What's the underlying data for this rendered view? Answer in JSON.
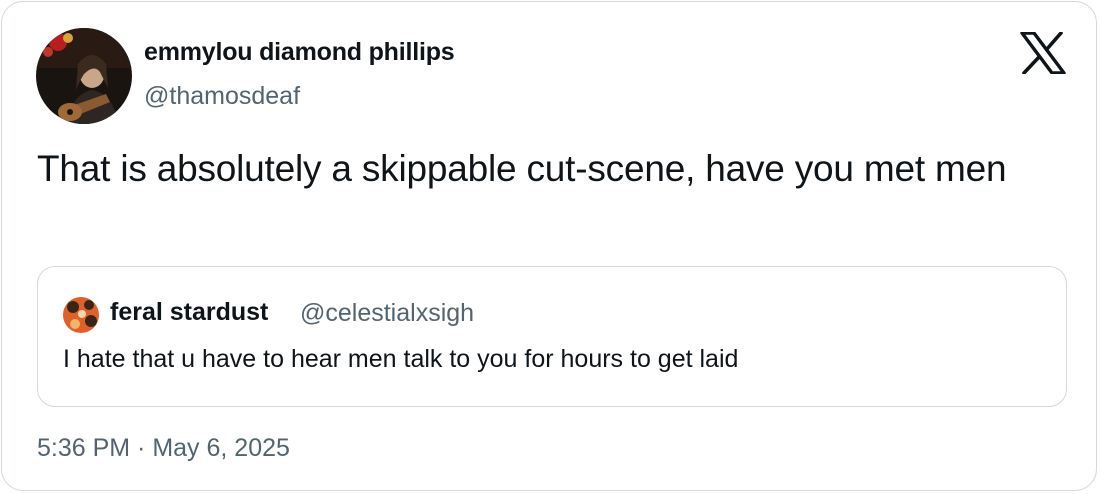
{
  "tweet": {
    "author_name": "emmylou diamond phillips",
    "author_handle": "@thamosdeaf",
    "text": "That is absolutely a skippable cut-scene, have you met men",
    "timestamp": "5:36 PM · May 6, 2025",
    "logo_icon": "x-logo-icon"
  },
  "quoted_tweet": {
    "author_name": "feral stardust",
    "author_handle": "@celestialxsigh",
    "text": "I hate that u have to hear men talk to you for hours to get laid"
  },
  "colors": {
    "text_primary": "#0f1419",
    "text_secondary": "#536471",
    "border": "#cfd9de",
    "background": "#ffffff"
  }
}
